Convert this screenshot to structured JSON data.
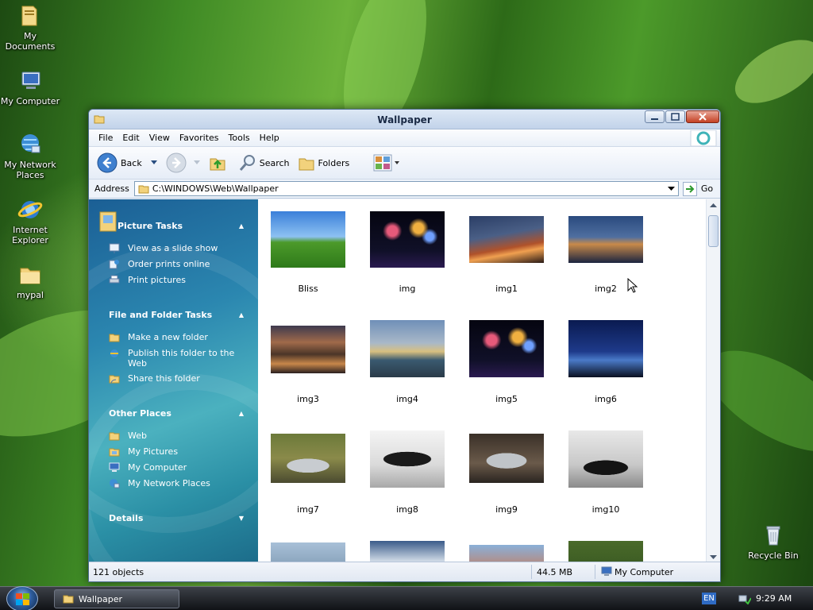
{
  "desktop": {
    "icons": [
      {
        "label": "My Documents",
        "icon": "folder-documents-icon"
      },
      {
        "label": "My Computer",
        "icon": "computer-icon"
      },
      {
        "label": "My Network",
        "label2": "Places",
        "icon": "network-icon"
      },
      {
        "label": "Internet",
        "label2": "Explorer",
        "icon": "internet-explorer-icon"
      },
      {
        "label": "mypal",
        "icon": "folder-icon"
      },
      {
        "label": "Recycle Bin",
        "icon": "recycle-bin-icon"
      }
    ]
  },
  "window": {
    "title": "Wallpaper",
    "menu": [
      "File",
      "Edit",
      "View",
      "Favorites",
      "Tools",
      "Help"
    ],
    "toolbar": {
      "back": "Back",
      "search": "Search",
      "folders": "Folders"
    },
    "address": {
      "label": "Address",
      "value": "C:\\WINDOWS\\Web\\Wallpaper",
      "go": "Go"
    }
  },
  "left_pane": {
    "picture_tasks": {
      "title": "Picture Tasks",
      "items": [
        "View as a slide show",
        "Order prints online",
        "Print pictures"
      ]
    },
    "file_folder_tasks": {
      "title": "File and Folder Tasks",
      "items": [
        "Make a new folder",
        "Publish this folder to the",
        "Web",
        "Share this folder"
      ]
    },
    "other_places": {
      "title": "Other Places",
      "items": [
        "Web",
        "My Pictures",
        "My Computer",
        "My Network Places"
      ]
    },
    "details": {
      "title": "Details"
    }
  },
  "files": [
    "Bliss",
    "img",
    "img1",
    "img2",
    "img3",
    "img4",
    "img5",
    "img6",
    "img7",
    "img8",
    "img9",
    "img10"
  ],
  "status": {
    "objects": "121 objects",
    "size": "44.5 MB",
    "location": "My Computer"
  },
  "taskbar": {
    "window_button": "Wallpaper",
    "language": "EN",
    "clock": "9:29 AM"
  }
}
